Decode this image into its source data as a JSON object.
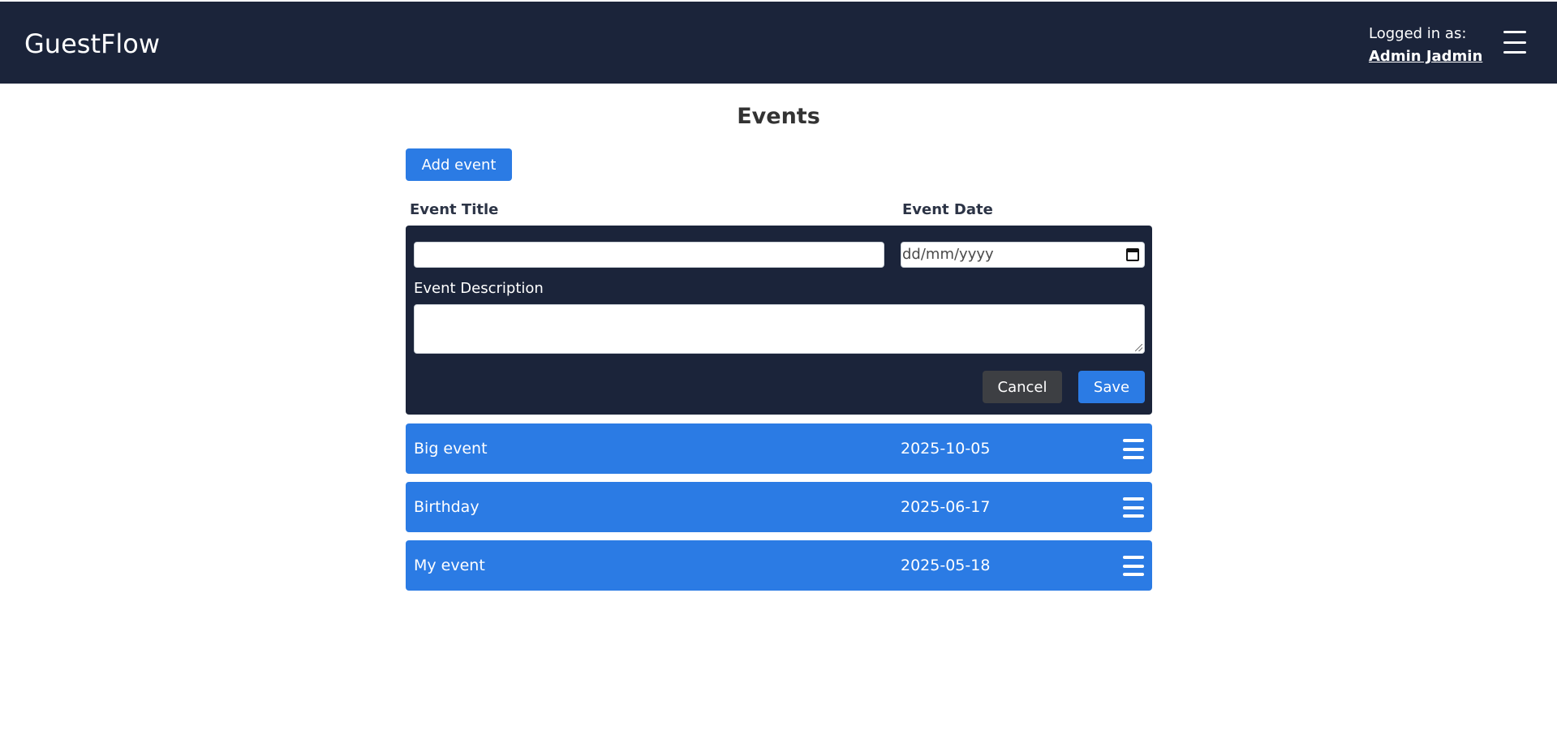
{
  "header": {
    "app_name": "GuestFlow",
    "logged_in_label": "Logged in as:",
    "user_name": "Admin Jadmin",
    "menu_icon": "hamburger-menu-icon"
  },
  "page": {
    "title": "Events",
    "add_event_label": "Add event"
  },
  "form": {
    "title_label": "Event Title",
    "date_label": "Event Date",
    "title_value": "",
    "date_placeholder": "dd/mm/yyyy",
    "date_icon": "calendar-icon",
    "description_label": "Event Description",
    "description_value": "",
    "cancel_label": "Cancel",
    "save_label": "Save"
  },
  "events": [
    {
      "title": "Big event",
      "date": "2025-10-05",
      "menu_icon": "hamburger-menu-icon"
    },
    {
      "title": "Birthday",
      "date": "2025-06-17",
      "menu_icon": "hamburger-menu-icon"
    },
    {
      "title": "My event",
      "date": "2025-05-18",
      "menu_icon": "hamburger-menu-icon"
    }
  ],
  "colors": {
    "navbar": "#1b243a",
    "primary": "#2b7be4",
    "cancel": "#3d3f43"
  }
}
